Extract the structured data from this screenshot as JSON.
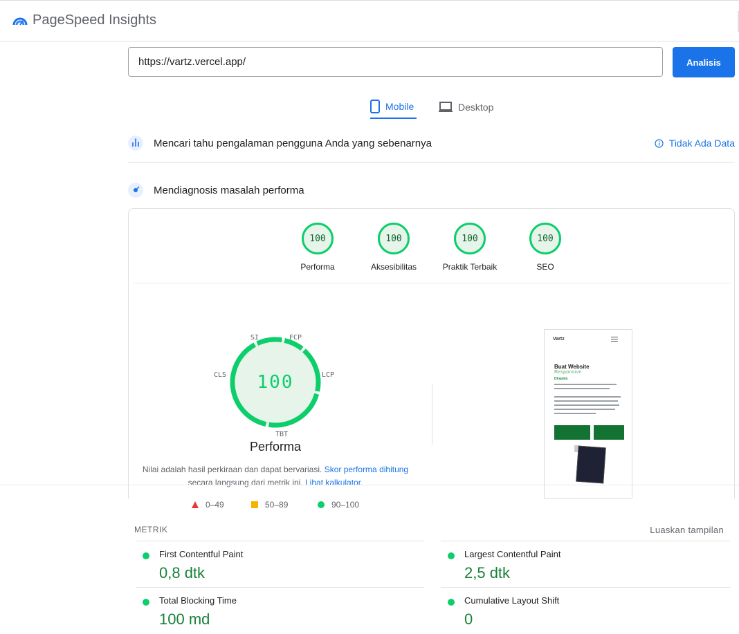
{
  "app": {
    "title": "PageSpeed Insights"
  },
  "url_bar": {
    "value": "https://vartz.vercel.app/",
    "analyze_label": "Analisis"
  },
  "tabs": [
    {
      "label": "Mobile",
      "selected": true
    },
    {
      "label": "Desktop",
      "selected": false
    }
  ],
  "field_data": {
    "title": "Mencari tahu pengalaman pengguna Anda yang sebenarnya",
    "status": "Tidak Ada Data"
  },
  "diagnostics": {
    "title": "Mendiagnosis masalah performa"
  },
  "scores": [
    {
      "value": "100",
      "label": "Performa"
    },
    {
      "value": "100",
      "label": "Aksesibilitas"
    },
    {
      "value": "100",
      "label": "Praktik Terbaik"
    },
    {
      "value": "100",
      "label": "SEO"
    }
  ],
  "performance": {
    "score": "100",
    "label": "Performa",
    "metric_tags": {
      "si": "SI",
      "fcp": "FCP",
      "lcp": "LCP",
      "tbt": "TBT",
      "cls": "CLS"
    },
    "note_1": "Nilai adalah hasil perkiraan dan dapat bervariasi. ",
    "note_link_1": "Skor performa dihitung",
    "note_2": " secara langsung dari metrik ini. ",
    "note_link_2": "Lihat kalkulator",
    "note_3": "."
  },
  "preview": {
    "logo": "Vartz",
    "headline": "Buat Website",
    "headline_2": "Responsive",
    "subheadline": "Dinamis"
  },
  "legend": [
    {
      "range": "0–49",
      "shape": "triangle",
      "color": "#e53935"
    },
    {
      "range": "50–89",
      "shape": "square",
      "color": "#f4b400"
    },
    {
      "range": "90–100",
      "shape": "circle",
      "color": "#0cce6b"
    }
  ],
  "metrics": {
    "header": "METRIK",
    "expand_label": "Luaskan tampilan",
    "items": [
      {
        "name": "First Contentful Paint",
        "value": "0,8 dtk"
      },
      {
        "name": "Largest Contentful Paint",
        "value": "2,5 dtk"
      },
      {
        "name": "Total Blocking Time",
        "value": "100 md"
      },
      {
        "name": "Cumulative Layout Shift",
        "value": "0"
      }
    ]
  },
  "colors": {
    "accent": "#1a73e8",
    "pass": "#0cce6b",
    "pass_text": "#188038"
  }
}
